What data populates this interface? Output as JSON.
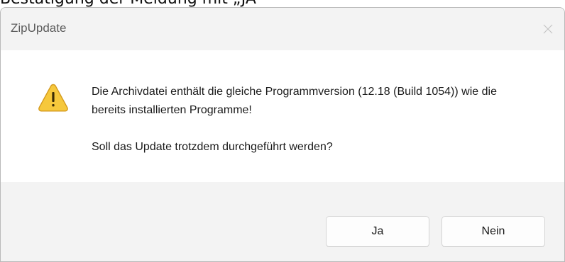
{
  "caption": "Bestätigung der Meldung mit „JA“",
  "dialog": {
    "title": "ZipUpdate",
    "close_glyph": "✕",
    "icon": "warning-icon",
    "message_line1": "Die Archivdatei enthält die gleiche Programmversion (12.18 (Build 1054)) wie die bereits installierten Programme!",
    "message_question": "Soll das Update trotzdem durchgeführt werden?",
    "buttons": {
      "yes_label": "Ja",
      "no_label": "Nein"
    }
  },
  "colors": {
    "warning_fill": "#f6c83c",
    "warning_outline": "#d49a1d",
    "titlebar_bg": "#f3f3f3",
    "content_bg": "#ffffff"
  }
}
